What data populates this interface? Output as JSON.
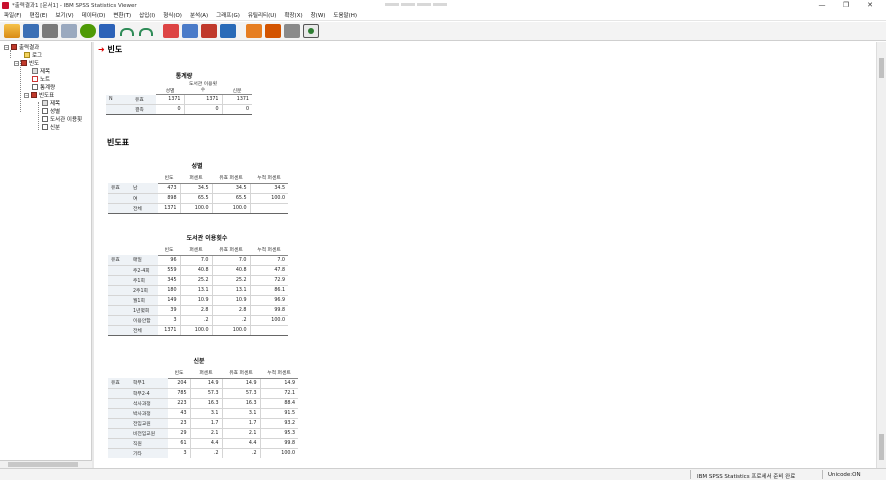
{
  "window": {
    "title": "*출력결과1 [문서1] - IBM SPSS Statistics Viewer",
    "minimize": "—",
    "restore": "❐",
    "close": "✕"
  },
  "menu": [
    "파일(F)",
    "편집(E)",
    "보기(V)",
    "데이터(D)",
    "변환(T)",
    "삽입(I)",
    "형식(O)",
    "분석(A)",
    "그래프(G)",
    "유틸리티(U)",
    "확장(X)",
    "창(W)",
    "도움말(H)"
  ],
  "outline": {
    "root": "출력결과",
    "log": "로그",
    "freq": "빈도",
    "freq_children": [
      "제목",
      "노트",
      "통계량",
      "빈도표"
    ],
    "freqtable_children": [
      "제목",
      "성별",
      "도서관 이용횟",
      "신분"
    ]
  },
  "content": {
    "section_title": "빈도",
    "stats": {
      "title": "통계량",
      "headers": [
        "성별",
        "도서관 이용횟수",
        "신분"
      ],
      "group": "N",
      "rows": [
        {
          "label": "유효",
          "values": [
            "1371",
            "1371",
            "1371"
          ]
        },
        {
          "label": "결측",
          "values": [
            "0",
            "0",
            "0"
          ]
        }
      ]
    },
    "freq_section_title": "빈도표",
    "table_headers": [
      "빈도",
      "퍼센트",
      "유효 퍼센트",
      "누적 퍼센트"
    ],
    "valid_label": "유효",
    "gender": {
      "title": "성별",
      "rows": [
        {
          "label": "남",
          "values": [
            "473",
            "34.5",
            "34.5",
            "34.5"
          ]
        },
        {
          "label": "여",
          "values": [
            "898",
            "65.5",
            "65.5",
            "100.0"
          ]
        },
        {
          "label": "전체",
          "values": [
            "1371",
            "100.0",
            "100.0",
            ""
          ]
        }
      ]
    },
    "visits": {
      "title": "도서관 이용횟수",
      "rows": [
        {
          "label": "매일",
          "values": [
            "96",
            "7.0",
            "7.0",
            "7.0"
          ]
        },
        {
          "label": "주2-4회",
          "values": [
            "559",
            "40.8",
            "40.8",
            "47.8"
          ]
        },
        {
          "label": "주1회",
          "values": [
            "345",
            "25.2",
            "25.2",
            "72.9"
          ]
        },
        {
          "label": "2주1회",
          "values": [
            "180",
            "13.1",
            "13.1",
            "86.1"
          ]
        },
        {
          "label": "월1회",
          "values": [
            "149",
            "10.9",
            "10.9",
            "96.9"
          ]
        },
        {
          "label": "1년몇회",
          "values": [
            "39",
            "2.8",
            "2.8",
            "99.8"
          ]
        },
        {
          "label": "이용안함",
          "values": [
            "3",
            ".2",
            ".2",
            "100.0"
          ]
        },
        {
          "label": "전체",
          "values": [
            "1371",
            "100.0",
            "100.0",
            ""
          ]
        }
      ]
    },
    "status": {
      "title": "신분",
      "rows": [
        {
          "label": "학부1",
          "values": [
            "204",
            "14.9",
            "14.9",
            "14.9"
          ]
        },
        {
          "label": "학부2-4",
          "values": [
            "785",
            "57.3",
            "57.3",
            "72.1"
          ]
        },
        {
          "label": "석사과정",
          "values": [
            "223",
            "16.3",
            "16.3",
            "88.4"
          ]
        },
        {
          "label": "박사과정",
          "values": [
            "43",
            "3.1",
            "3.1",
            "91.5"
          ]
        },
        {
          "label": "전임교원",
          "values": [
            "23",
            "1.7",
            "1.7",
            "93.2"
          ]
        },
        {
          "label": "비전임교원",
          "values": [
            "29",
            "2.1",
            "2.1",
            "95.3"
          ]
        },
        {
          "label": "직원",
          "values": [
            "61",
            "4.4",
            "4.4",
            "99.8"
          ]
        },
        {
          "label": "기타",
          "values": [
            "3",
            ".2",
            ".2",
            "100.0"
          ]
        }
      ]
    }
  },
  "statusbar": {
    "message": "IBM SPSS Statistics 프로세서 준비 완료",
    "unicode": "Unicode:ON"
  }
}
